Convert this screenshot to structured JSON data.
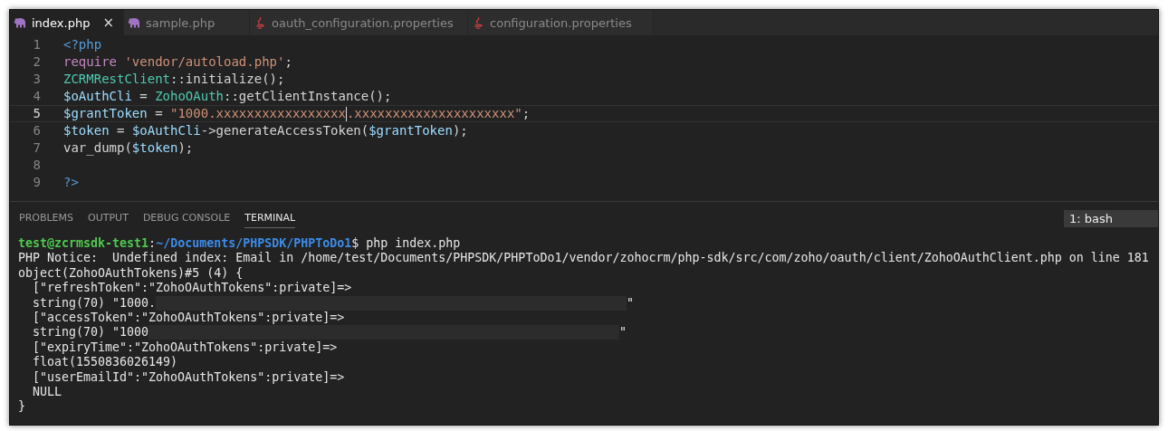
{
  "editor_tabs": [
    {
      "label": "index.php",
      "kind": "php",
      "selected": true,
      "close": "×"
    },
    {
      "label": "sample.php",
      "kind": "php",
      "selected": false
    },
    {
      "label": "oauth_configuration.properties",
      "kind": "java",
      "selected": false
    },
    {
      "label": "configuration.properties",
      "kind": "java",
      "selected": false
    }
  ],
  "code_lines": [
    {
      "number": "1",
      "current": false,
      "tokens": [
        {
          "kind": "tag",
          "text": "<?php"
        }
      ]
    },
    {
      "number": "2",
      "current": false,
      "tokens": [
        {
          "kind": "keyword",
          "text": "require "
        },
        {
          "kind": "string",
          "text": "'vendor/autoload.php'"
        },
        {
          "kind": "plain",
          "text": ";"
        }
      ]
    },
    {
      "number": "3",
      "current": false,
      "tokens": [
        {
          "kind": "class",
          "text": "ZCRMRestClient"
        },
        {
          "kind": "plain",
          "text": "::initialize();"
        }
      ]
    },
    {
      "number": "4",
      "current": false,
      "tokens": [
        {
          "kind": "variable",
          "text": "$oAuthCli"
        },
        {
          "kind": "plain",
          "text": " = "
        },
        {
          "kind": "class",
          "text": "ZohoOAuth"
        },
        {
          "kind": "plain",
          "text": "::getClientInstance();"
        }
      ]
    },
    {
      "number": "5",
      "current": true,
      "tokens": [
        {
          "kind": "variable",
          "text": "$grantToken"
        },
        {
          "kind": "plain",
          "text": " = "
        },
        {
          "kind": "string",
          "text": "\"1000.xxxxxxxxxxxxxxxxx"
        },
        {
          "kind": "cursor"
        },
        {
          "kind": "string",
          "text": ".xxxxxxxxxxxxxxxxxxxxx\""
        },
        {
          "kind": "plain",
          "text": ";"
        }
      ]
    },
    {
      "number": "6",
      "current": false,
      "tokens": [
        {
          "kind": "variable",
          "text": "$token"
        },
        {
          "kind": "plain",
          "text": " = "
        },
        {
          "kind": "variable",
          "text": "$oAuthCli"
        },
        {
          "kind": "plain",
          "text": "->generateAccessToken("
        },
        {
          "kind": "variable",
          "text": "$grantToken"
        },
        {
          "kind": "plain",
          "text": ");"
        }
      ]
    },
    {
      "number": "7",
      "current": false,
      "tokens": [
        {
          "kind": "plain",
          "text": "var_dump("
        },
        {
          "kind": "variable",
          "text": "$token"
        },
        {
          "kind": "plain",
          "text": ");"
        }
      ]
    },
    {
      "number": "8",
      "current": false
    },
    {
      "number": "9",
      "current": false,
      "tokens": [
        {
          "kind": "tag",
          "text": "?>"
        }
      ]
    }
  ],
  "panel_tabs": [
    {
      "label": "PROBLEMS",
      "selected": false
    },
    {
      "label": "OUTPUT",
      "selected": false
    },
    {
      "label": "DEBUG CONSOLE",
      "selected": false
    },
    {
      "label": "TERMINAL",
      "selected": true
    }
  ],
  "terminal_selector": "1: bash",
  "terminal_lines": [
    [
      {
        "kind": "user",
        "text": "test@zcrmsdk-test1"
      },
      {
        "kind": "plain",
        "text": ":"
      },
      {
        "kind": "path",
        "text": "~/Documents/PHPSDK/PHPToDo1"
      },
      {
        "kind": "plain",
        "text": "$ php index.php"
      }
    ],
    [
      {
        "kind": "plain",
        "text": "PHP Notice:  Undefined index: Email in /home/test/Documents/PHPSDK/PHPToDo1/vendor/zohocrm/php-sdk/src/com/zoho/oauth/client/ZohoOAuthClient.php on line 181"
      }
    ],
    [
      {
        "kind": "plain",
        "text": "object(ZohoOAuthTokens)#5 (4) {"
      }
    ],
    [
      {
        "kind": "plain",
        "text": "  [\"refreshToken\":\"ZohoOAuthTokens\":private]=>"
      }
    ],
    [
      {
        "kind": "plain",
        "text": "  string(70) \"1000."
      },
      {
        "kind": "redacted"
      },
      {
        "kind": "plain",
        "text": "\""
      }
    ],
    [
      {
        "kind": "plain",
        "text": "  [\"accessToken\":\"ZohoOAuthTokens\":private]=>"
      }
    ],
    [
      {
        "kind": "plain",
        "text": "  string(70) \"1000"
      },
      {
        "kind": "redacted"
      },
      {
        "kind": "plain",
        "text": "\""
      }
    ],
    [
      {
        "kind": "plain",
        "text": "  [\"expiryTime\":\"ZohoOAuthTokens\":private]=>"
      }
    ],
    [
      {
        "kind": "plain",
        "text": "  float(1550836026149)"
      }
    ],
    [
      {
        "kind": "plain",
        "text": "  [\"userEmailId\":\"ZohoOAuthTokens\":private]=>"
      }
    ],
    [
      {
        "kind": "plain",
        "text": "  NULL"
      }
    ],
    [
      {
        "kind": "plain",
        "text": "}"
      }
    ]
  ]
}
